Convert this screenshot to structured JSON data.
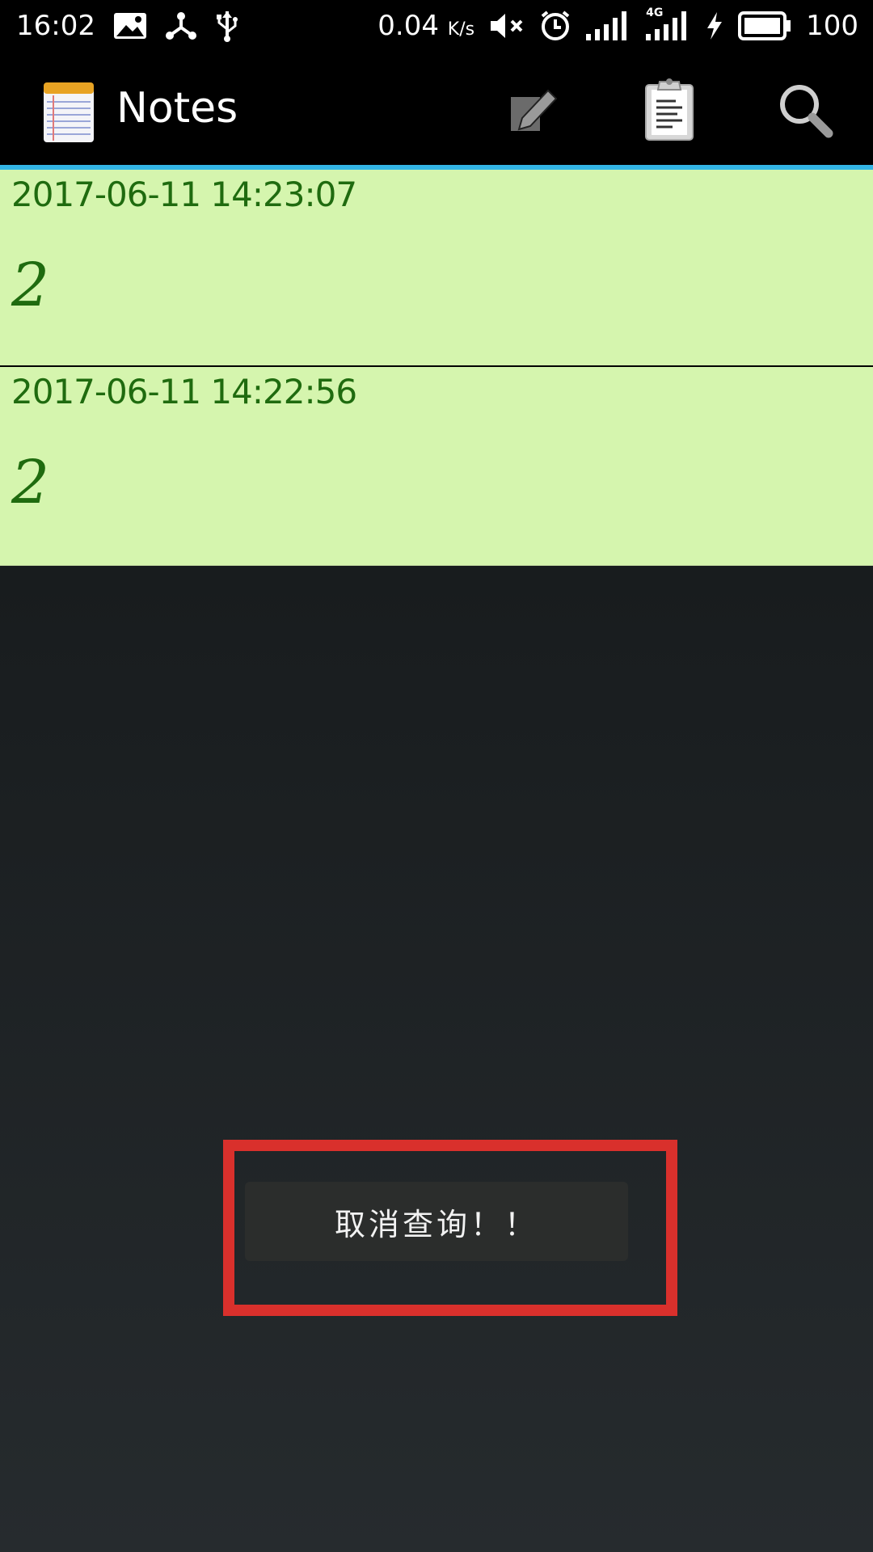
{
  "status_bar": {
    "time": "16:02",
    "net_speed": "0.04",
    "net_unit": "K/s",
    "network_type": "4G",
    "battery": "100",
    "icons": [
      "image-notification-icon",
      "share-icon",
      "usb-icon",
      "mute-icon",
      "alarm-icon",
      "signal-icon",
      "signal-4g-icon",
      "charging-icon",
      "battery-icon"
    ]
  },
  "app_bar": {
    "title": "Notes",
    "actions": [
      "new-note-icon",
      "paste-icon",
      "search-icon"
    ],
    "accent_color": "#33b5e5"
  },
  "notes": [
    {
      "date": "2017-06-11  14:23:07",
      "title": "2"
    },
    {
      "date": "2017-06-11  14:22:56",
      "title": "2"
    }
  ],
  "toast": {
    "message": "取消查询！！"
  },
  "colors": {
    "note_background": "#d5f5ae",
    "note_text": "#1f6b0f",
    "highlight_border": "#d9302c"
  }
}
